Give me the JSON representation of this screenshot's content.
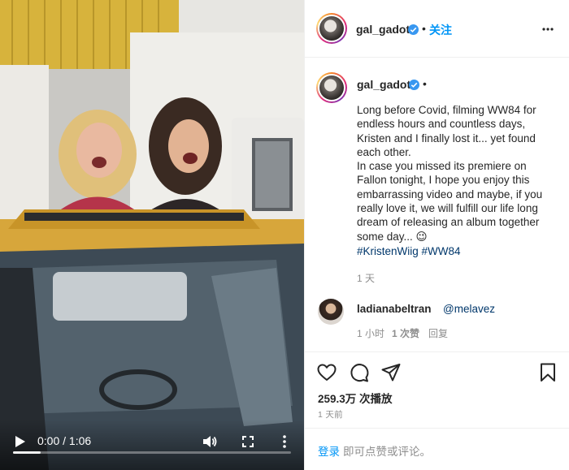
{
  "video": {
    "time_current": "0:00",
    "time_separator": " / ",
    "time_total": "1:06",
    "progress_fraction": 0.1
  },
  "post": {
    "username": "gal_gadot",
    "follow_label": "关注",
    "dot": "•",
    "caption": "Long before Covid, filming WW84 for endless hours and countless days, Kristen and I finally lost it... yet found each other.\nIn case you missed its premiere on Fallon tonight, I hope you enjoy this embarrassing video and maybe, if you really love it, we will fulfill our life long dream of releasing an album together some day... 😉",
    "hashtags": [
      "#KristenWiig",
      "#WW84"
    ],
    "caption_time": "1 天"
  },
  "comment": {
    "username": "ladianabeltran",
    "mention": "@melavez",
    "time": "1 小时",
    "likes": "1 次赞",
    "reply_label": "回复"
  },
  "stats": {
    "views": "259.3万 次播放",
    "posted_ago": "1 天前"
  },
  "login": {
    "link": "登录",
    "text": "即可点赞或评论。"
  },
  "colors": {
    "accent_blue": "#0095f6",
    "verified_blue": "#3897f0",
    "hashtag_blue": "#00376b",
    "muted_gray": "#8e8e8e"
  },
  "icons": [
    "play-icon",
    "volume-icon",
    "fullscreen-icon",
    "more-vertical-icon",
    "verified-icon",
    "more-horizontal-icon",
    "heart-icon",
    "comment-icon",
    "share-icon",
    "bookmark-icon"
  ]
}
